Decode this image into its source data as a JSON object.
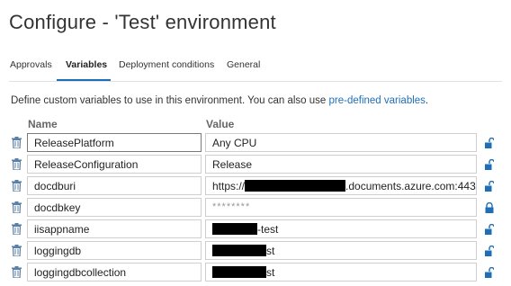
{
  "page": {
    "title": "Configure - 'Test' environment"
  },
  "tabs": [
    {
      "label": "Approvals",
      "active": false
    },
    {
      "label": "Variables",
      "active": true
    },
    {
      "label": "Deployment conditions",
      "active": false
    },
    {
      "label": "General",
      "active": false
    }
  ],
  "description": {
    "text": "Define custom variables to use in this environment. You can also use ",
    "link": "pre-defined variables",
    "suffix": "."
  },
  "columns": {
    "name": "Name",
    "value": "Value"
  },
  "variables": [
    {
      "name": "ReleasePlatform",
      "value": "Any CPU",
      "secret": false,
      "name_focused": true,
      "locked": false
    },
    {
      "name": "ReleaseConfiguration",
      "value": "Release",
      "secret": false,
      "locked": false
    },
    {
      "name": "docdburi",
      "value_prefix": "https://",
      "value_suffix": ".documents.azure.com:443/",
      "redacted": true,
      "secret": false,
      "locked": false
    },
    {
      "name": "docdbkey",
      "value": "********",
      "secret": true,
      "locked": true
    },
    {
      "name": "iisappname",
      "value_suffix": "-test",
      "redacted": true,
      "secret": false,
      "locked": false
    },
    {
      "name": "loggingdb",
      "value_suffix": "st",
      "redacted": true,
      "secret": false,
      "locked": false
    },
    {
      "name": "loggingdbcollection",
      "value_suffix": "st",
      "redacted": true,
      "secret": false,
      "locked": false
    }
  ],
  "icons": {
    "delete": "trash-icon",
    "unlocked": "unlock-icon",
    "locked": "lock-icon"
  },
  "colors": {
    "accent": "#1f6fb5",
    "link": "#1e6fb8",
    "icon": "#1e6fb8"
  }
}
